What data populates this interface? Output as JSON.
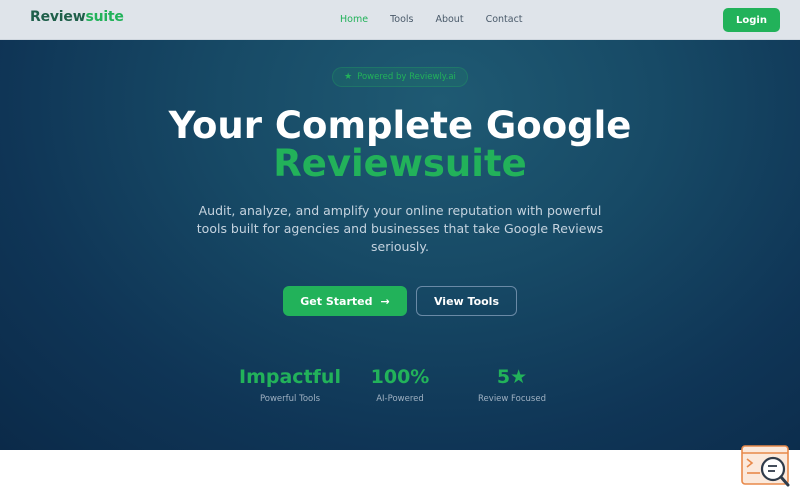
{
  "nav": {
    "logo_part_a": "Review",
    "logo_part_b": "suite",
    "links": [
      "Home",
      "Tools",
      "About",
      "Contact"
    ],
    "active_link": "Home",
    "login_label": "Login"
  },
  "hero": {
    "badge": "Powered by Reviewly.ai",
    "title_line1": "Your Complete Google",
    "title_line2": "Reviewsuite",
    "subtitle": "Audit, analyze, and amplify your online reputation with powerful tools built for agencies and businesses that take Google Reviews seriously.",
    "cta_primary": "Get Started",
    "cta_secondary": "View Tools"
  },
  "stats": [
    {
      "value": "Impactful",
      "label": "Powerful Tools"
    },
    {
      "value": "100%",
      "label": "AI-Powered"
    },
    {
      "value": "5★",
      "label": "Review Focused"
    }
  ],
  "colors": {
    "brand_green": "#22b25a",
    "hero_dark": "#0f3556",
    "nav_bg": "#dfe4ea"
  },
  "icons": {
    "badge": "star-icon",
    "cta_arrow": "arrow-right-icon",
    "widget": "search-chat-icon"
  }
}
